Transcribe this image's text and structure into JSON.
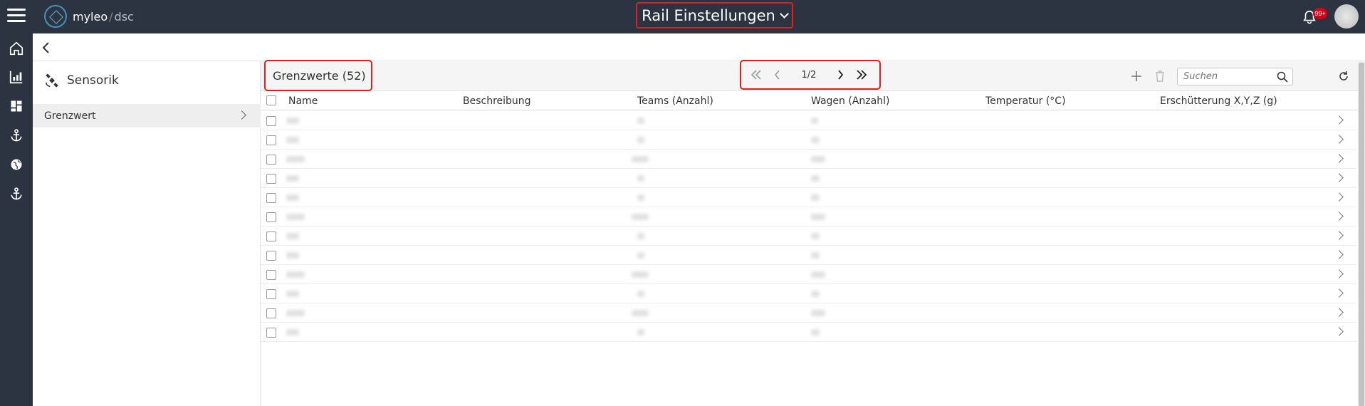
{
  "app": {
    "brand": "myleo",
    "brand_sep": "/",
    "brand_sub": "dsc"
  },
  "header": {
    "title": "Rail Einstellungen",
    "notification_badge": "99+"
  },
  "nav_rail": {
    "icons": [
      "home-icon",
      "chart-icon",
      "dashboard-icon",
      "anchor-icon",
      "globe-icon",
      "anchor-icon"
    ]
  },
  "sidepanel": {
    "title": "Sensorik",
    "items": [
      {
        "label": "Grenzwert"
      }
    ]
  },
  "toolbar": {
    "title": "Grenzwerte (52)",
    "pagination": {
      "current": 1,
      "total": 2,
      "text": "1/2"
    },
    "search_placeholder": "Suchen"
  },
  "table": {
    "columns": [
      "Name",
      "Beschreibung",
      "Teams (Anzahl)",
      "Wagen (Anzahl)",
      "Temperatur (°C)",
      "Erschütterung X,Y,Z (g)"
    ],
    "row_count": 12,
    "note_values_blurred": true
  },
  "colors": {
    "topbar": "#2b3440",
    "highlight": "#e0201e",
    "badge": "#d0021b"
  }
}
